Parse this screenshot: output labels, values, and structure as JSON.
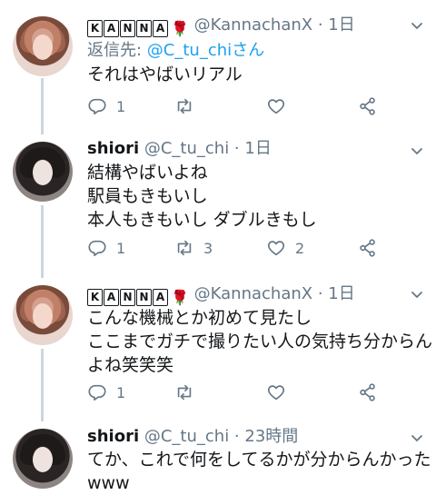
{
  "tweets": [
    {
      "name_chars": [
        "K",
        "A",
        "N",
        "N",
        "A"
      ],
      "name_suffix": "🌹",
      "handle": "@KannachanX",
      "time": "1日",
      "reply_prefix": "返信先: ",
      "reply_to": "@C_tu_chiさん",
      "lines": [
        "それはやばいリアル"
      ],
      "replies": "1",
      "retweets": "",
      "likes": ""
    },
    {
      "name": "shiori",
      "handle": "@C_tu_chi",
      "time": "1日",
      "lines": [
        "結構やばいよね",
        "駅員もきもいし",
        "本人もきもいし ダブルきもし"
      ],
      "replies": "1",
      "retweets": "3",
      "likes": "2"
    },
    {
      "name_chars": [
        "K",
        "A",
        "N",
        "N",
        "A"
      ],
      "name_suffix": "🌹",
      "handle": "@KannachanX",
      "time": "1日",
      "lines": [
        "こんな機械とか初めて見たし",
        "ここまでガチで撮りたい人の気持ち分からん",
        "よね笑笑笑"
      ],
      "replies": "1",
      "retweets": "",
      "likes": ""
    },
    {
      "name": "shiori",
      "handle": "@C_tu_chi",
      "time": "23時間",
      "lines": [
        "てか、これで何をしてるかが分からんかった",
        "www"
      ]
    }
  ],
  "separator": " · ",
  "icons": {
    "reply": "reply-icon",
    "retweet": "retweet-icon",
    "like": "heart-icon",
    "share": "share-icon",
    "menu": "chevron-down-icon"
  },
  "colors": {
    "text": "#14171a",
    "secondary": "#657786",
    "link": "#1da1f2",
    "thread_line": "#ccd6dd",
    "rose": "#c81e1e"
  }
}
